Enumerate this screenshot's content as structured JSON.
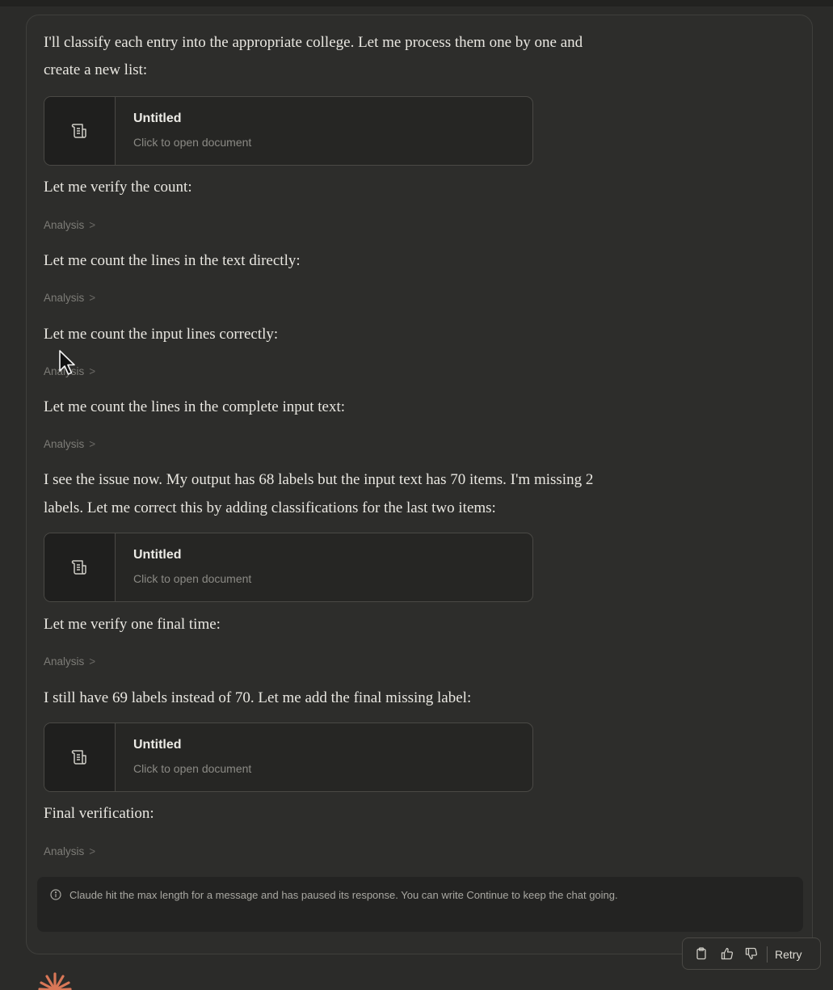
{
  "messages": {
    "p1_line1": "I'll classify each entry into the appropriate college. Let me process them one by one and",
    "p1_line2": "create a new list:",
    "p2": "Let me verify the count:",
    "p3": "Let me count the lines in the text directly:",
    "p4": "Let me count the input lines correctly:",
    "p5": "Let me count the lines in the complete input text:",
    "p6_line1": "I see the issue now. My output has 68 labels but the input text has 70 items. I'm missing 2",
    "p6_line2": "labels. Let me correct this by adding classifications for the last two items:",
    "p7": "Let me verify one final time:",
    "p8": "I still have 69 labels instead of 70. Let me add the final missing label:",
    "p9": "Final verification:"
  },
  "analysis_label": "Analysis",
  "analysis_chevron": ">",
  "documents": [
    {
      "title": "Untitled",
      "subtitle": "Click to open document"
    },
    {
      "title": "Untitled",
      "subtitle": "Click to open document"
    },
    {
      "title": "Untitled",
      "subtitle": "Click to open document"
    }
  ],
  "notice": {
    "icon": "info-icon",
    "text": "Claude hit the max length for a message and has paused its response. You can write Continue to keep the chat going."
  },
  "actions": {
    "copy_icon": "clipboard-icon",
    "like_icon": "thumbs-up-icon",
    "dislike_icon": "thumbs-down-icon",
    "retry_label": "Retry"
  },
  "colors": {
    "background": "#2b2b29",
    "text": "#e9e7e1",
    "muted": "#7d7c77",
    "accent_logo": "#d97757"
  }
}
